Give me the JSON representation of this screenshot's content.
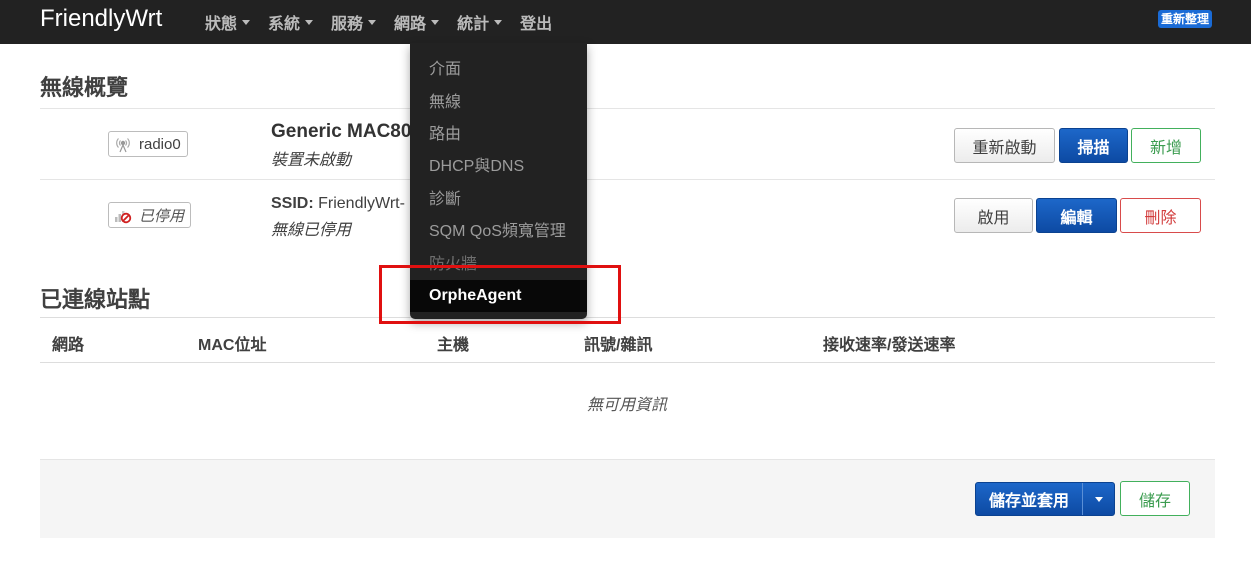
{
  "navbar": {
    "brand": "FriendlyWrt",
    "menu": [
      {
        "label": "狀態"
      },
      {
        "label": "系統"
      },
      {
        "label": "服務"
      },
      {
        "label": "網路"
      },
      {
        "label": "統計"
      },
      {
        "label": "登出"
      }
    ],
    "refresh_badge": "重新整理"
  },
  "dropdown": {
    "items": [
      "介面",
      "無線",
      "路由",
      "DHCP與DNS",
      "診斷",
      "SQM QoS頻寬管理",
      "防火牆",
      "OrpheAgent"
    ],
    "active_item": "OrpheAgent"
  },
  "wireless": {
    "title": "無線概覽",
    "device": {
      "badge": "radio0",
      "name": "Generic MAC80",
      "status": "裝置未啟動",
      "buttons": {
        "restart": "重新啟動",
        "scan": "掃描",
        "add": "新增"
      }
    },
    "network": {
      "badge": "已停用",
      "ssid_label": "SSID:",
      "ssid_value": "FriendlyWrt-",
      "status": "無線已停用",
      "buttons": {
        "enable": "啟用",
        "edit": "編輯",
        "delete": "刪除"
      }
    }
  },
  "stations": {
    "title": "已連線站點",
    "columns": [
      "網路",
      "MAC位址",
      "主機",
      "訊號/雜訊",
      "接收速率/發送速率"
    ],
    "empty": "無可用資訊"
  },
  "footer": {
    "save_apply": "儲存並套用",
    "save": "儲存"
  },
  "colors": {
    "navbar_bg": "#222222",
    "primary": "#0d4aa3",
    "success": "#3c9c50",
    "danger": "#d23c3c",
    "highlight": "#e01010"
  }
}
